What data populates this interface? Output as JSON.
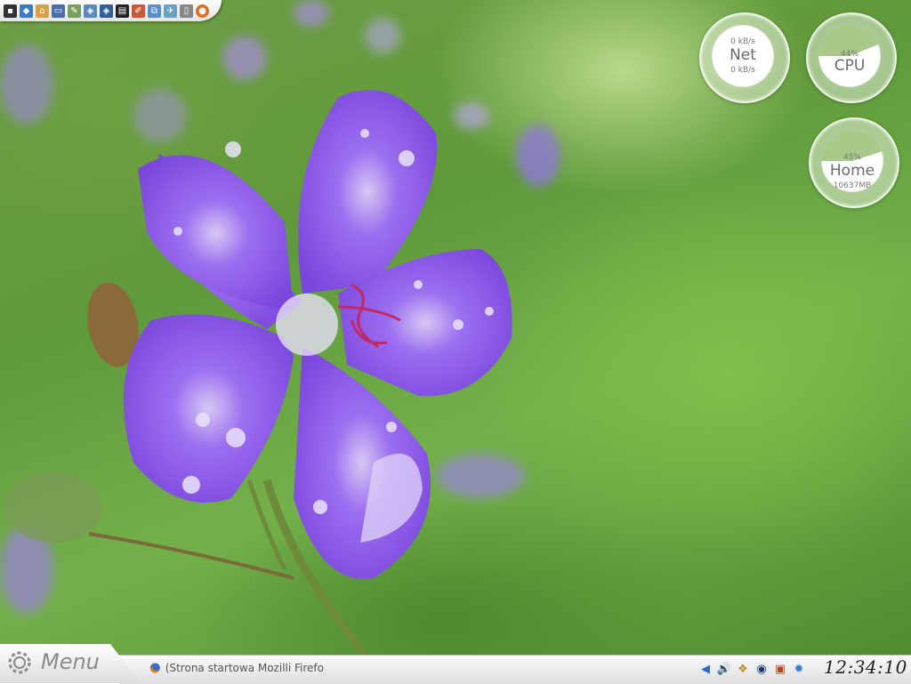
{
  "quicklaunch": {
    "icons": [
      "terminal-icon",
      "kontrol-icon",
      "home-folder-icon",
      "monitor-icon",
      "editor-icon",
      "package-icon",
      "package2-icon",
      "film-icon",
      "text-editor-icon",
      "network-icon",
      "scanner-icon",
      "document-icon",
      "firefox-icon"
    ]
  },
  "gauges": {
    "net": {
      "title": "Net",
      "up": "0 kB/s",
      "down": "0 kB/s"
    },
    "cpu": {
      "title": "CPU",
      "percent": "44%",
      "level": 0.44
    },
    "home": {
      "title": "Home",
      "percent": "45%",
      "level": 0.45,
      "size": "10637MB"
    }
  },
  "taskbar": {
    "menu_label": "Menu",
    "task_label": "(Strona startowa Mozilli Firefo",
    "clock": "12:34:10",
    "tray_icons": [
      "arrow-left-icon",
      "volume-icon",
      "klipper-icon",
      "globe-icon",
      "calendar-icon",
      "settings-icon"
    ]
  },
  "colors": {
    "accent_green": "#8fb86e",
    "flower": "#8a5ee0"
  }
}
